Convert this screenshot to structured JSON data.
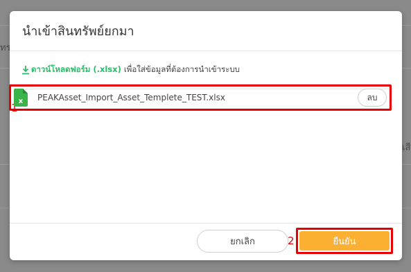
{
  "modal": {
    "title": "นำเข้าสินทรัพย์ยกมา",
    "download_link": "ดาวน์โหลดฟอร์ม (.xlsx)",
    "download_hint": "เพื่อใส่ข้อมูลที่ต้องการนำเข้าระบบ",
    "file": {
      "name": "PEAKAsset_Import_Asset_Templete_TEST.xlsx",
      "icon": "excel-file-icon",
      "delete_label": "ลบ"
    },
    "cancel_label": "ยกเลิก",
    "confirm_label": "ยืนยัน"
  },
  "annotations": {
    "marker_1": "1",
    "marker_2": "2"
  },
  "background": {
    "fragment_left": "ทร",
    "fragment_right": "เสี"
  },
  "colors": {
    "accent_green": "#2dba6a",
    "confirm_orange": "#fbb034",
    "highlight_red": "#e60000"
  }
}
